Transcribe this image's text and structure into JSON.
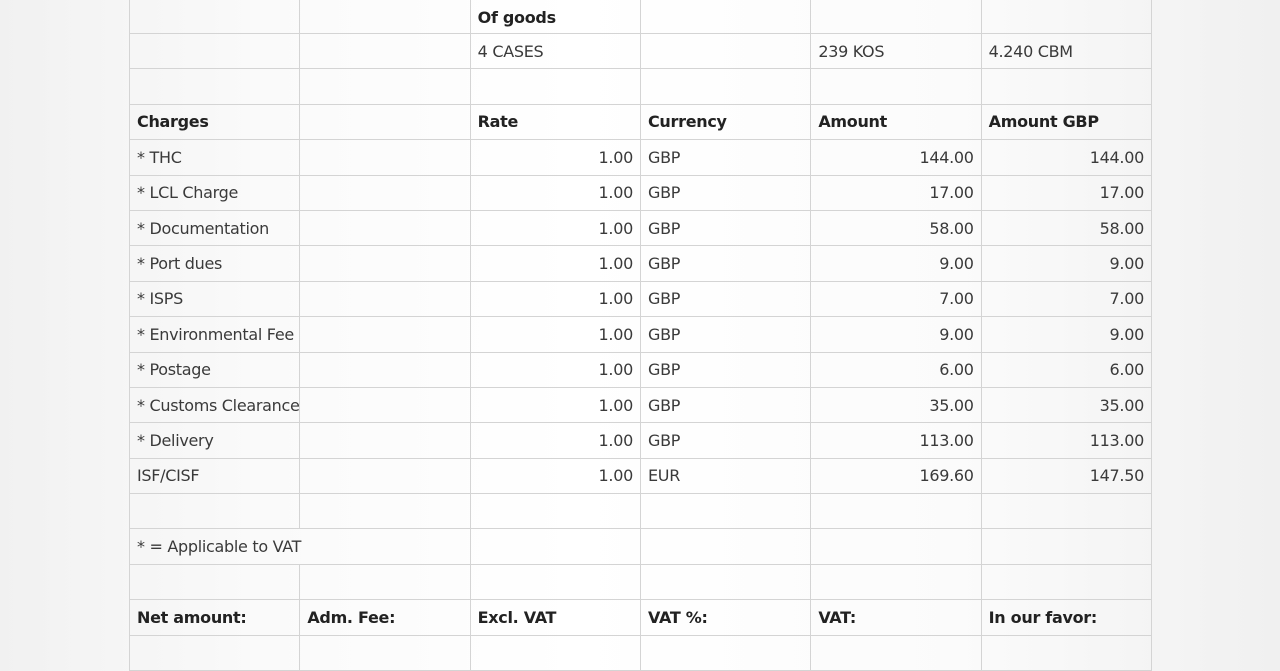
{
  "goods": {
    "header": "Of goods",
    "packages": "4 CASES",
    "weight": "239 KOS",
    "volume": "4.240 CBM"
  },
  "charges_header": {
    "charges": "Charges",
    "rate": "Rate",
    "currency": "Currency",
    "amount": "Amount",
    "amount_gbp": "Amount GBP"
  },
  "charges": [
    {
      "name": "* THC",
      "rate": "1.00",
      "currency": "GBP",
      "amount": "144.00",
      "amount_gbp": "144.00"
    },
    {
      "name": "* LCL Charge",
      "rate": "1.00",
      "currency": "GBP",
      "amount": "17.00",
      "amount_gbp": "17.00"
    },
    {
      "name": "* Documentation",
      "rate": "1.00",
      "currency": "GBP",
      "amount": "58.00",
      "amount_gbp": "58.00"
    },
    {
      "name": "* Port dues",
      "rate": "1.00",
      "currency": "GBP",
      "amount": "9.00",
      "amount_gbp": "9.00"
    },
    {
      "name": "* ISPS",
      "rate": "1.00",
      "currency": "GBP",
      "amount": "7.00",
      "amount_gbp": "7.00"
    },
    {
      "name": "* Environmental Fee",
      "rate": "1.00",
      "currency": "GBP",
      "amount": "9.00",
      "amount_gbp": "9.00"
    },
    {
      "name": "* Postage",
      "rate": "1.00",
      "currency": "GBP",
      "amount": "6.00",
      "amount_gbp": "6.00"
    },
    {
      "name": "* Customs Clearance",
      "rate": "1.00",
      "currency": "GBP",
      "amount": "35.00",
      "amount_gbp": "35.00"
    },
    {
      "name": "* Delivery",
      "rate": "1.00",
      "currency": "GBP",
      "amount": "113.00",
      "amount_gbp": "113.00"
    },
    {
      "name": "ISF/CISF",
      "rate": "1.00",
      "currency": "EUR",
      "amount": "169.60",
      "amount_gbp": "147.50"
    }
  ],
  "vat_note": "* = Applicable to VAT",
  "summary_header": {
    "net_amount": "Net amount:",
    "adm_fee": "Adm. Fee:",
    "excl_vat": "Excl. VAT",
    "vat_pct": "VAT %:",
    "vat": "VAT:",
    "in_our_favor": "In our favor:"
  }
}
